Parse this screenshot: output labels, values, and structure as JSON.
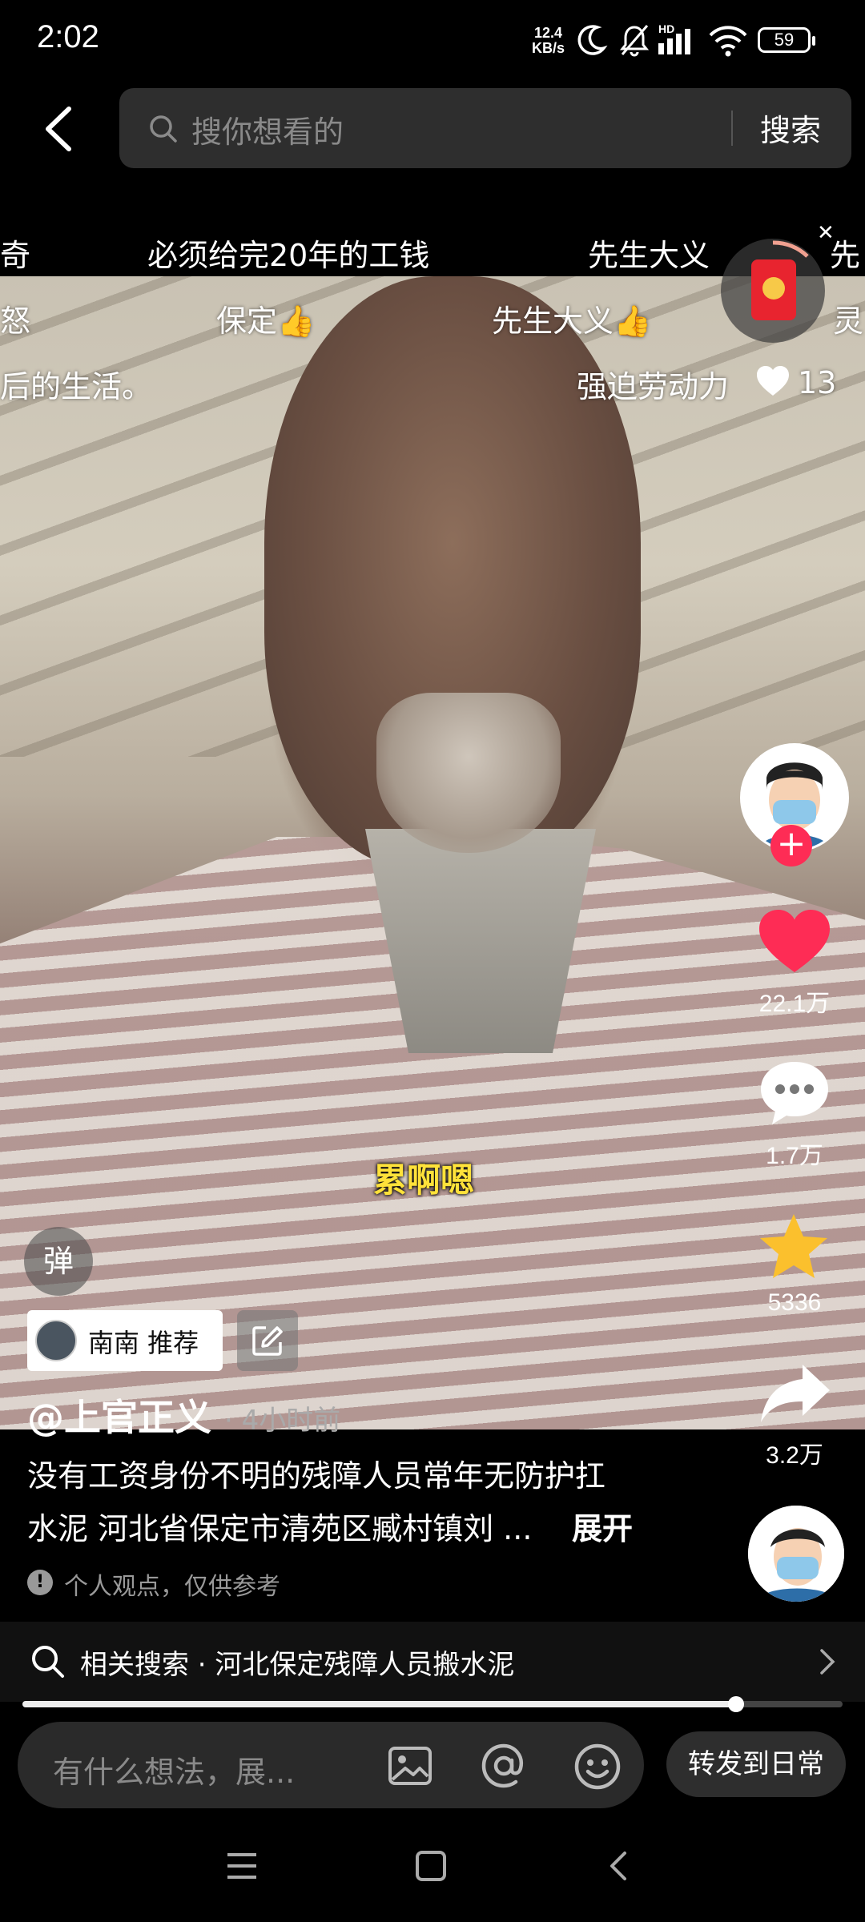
{
  "status_bar": {
    "time": "2:02",
    "net_speed_value": "12.4",
    "net_speed_unit": "KB/s",
    "signal_label": "HD",
    "battery": "59"
  },
  "search": {
    "placeholder": "搜你想看的",
    "button_label": "搜索"
  },
  "danmaku": [
    "奇",
    "必须给完20年的工钱",
    "先生大义",
    "先",
    "怒",
    "保定👍",
    "先生大义👍",
    "灵",
    "后的生活。",
    "强迫劳动力"
  ],
  "danmaku_like_count": "13",
  "video": {
    "caption": "累啊嗯"
  },
  "rail": {
    "likes": "22.1万",
    "comments": "1.7万",
    "favorites": "5336",
    "shares": "3.2万"
  },
  "danmaku_toggle": "弹",
  "recommend": {
    "text": "南南 推荐"
  },
  "post": {
    "author": "@上官正义",
    "time": "· 4小时前",
    "desc_line1": "没有工资身份不明的残障人员常年无防护扛",
    "desc_line2": "水泥 河北省保定市清苑区臧村镇刘 ...",
    "expand": "展开",
    "disclaimer": "个人观点，仅供参考"
  },
  "related": {
    "label": "相关搜索 · 河北保定残障人员搬水泥"
  },
  "progress": {
    "fraction": 0.87
  },
  "comment": {
    "placeholder": "有什么想法，展...",
    "share_button": "转发到日常"
  },
  "colors": {
    "like": "#fe2c55",
    "star": "#fbc02d",
    "caption": "#ffe23a"
  }
}
